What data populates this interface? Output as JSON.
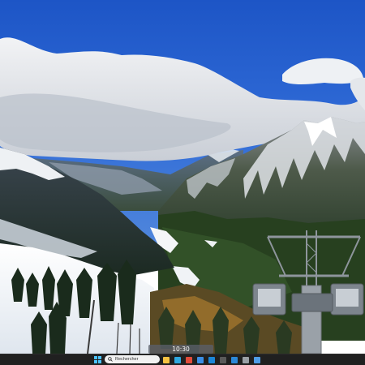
{
  "overlay": {
    "time": "10:30"
  },
  "taskbar": {
    "search_placeholder": "Rechercher",
    "start_icon": "windows-start-icon",
    "apps": [
      {
        "name": "file-explorer-icon",
        "color": "#f5c242"
      },
      {
        "name": "edge-icon",
        "color": "#2fa8e0"
      },
      {
        "name": "chrome-icon",
        "color": "#e24c3b"
      },
      {
        "name": "store-icon",
        "color": "#3a8ee6"
      },
      {
        "name": "mail-icon",
        "color": "#1b86d8"
      },
      {
        "name": "terminal-icon",
        "color": "#5a5a5a"
      },
      {
        "name": "photos-icon",
        "color": "#2b88d8"
      },
      {
        "name": "settings-icon",
        "color": "#9aa0a6"
      },
      {
        "name": "app-icon",
        "color": "#4f9de8"
      }
    ]
  },
  "colors": {
    "sky_top": "#1f56c4",
    "sky_bottom": "#3d7be0",
    "cloud": "#e6e8ec",
    "taskbar": "#202020",
    "accent": "#4cc2ff"
  }
}
